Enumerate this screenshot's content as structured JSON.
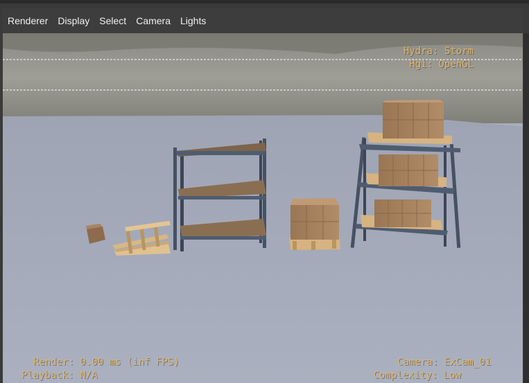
{
  "menu": {
    "items": [
      "Renderer",
      "Display",
      "Select",
      "Camera",
      "Lights"
    ]
  },
  "hud": {
    "renderer_line": "Hydra: Storm",
    "hgi_line": "Hgi: OpenGL",
    "render_line": "Render: 0.00 ms (inf FPS)",
    "playback_line": "Playback: N/A",
    "camera_line": "Camera: ExCam_01",
    "complexity_line": "Complexity: Low"
  },
  "colors": {
    "hud_text": "#e0b66e",
    "floor": "#a7adbc",
    "menubar": "#3d3d3d",
    "shelf_frame": "#4a5566",
    "shelf_board": "#8a6d4f",
    "box": "#a07e5c",
    "pallet": "#d9b98a"
  }
}
